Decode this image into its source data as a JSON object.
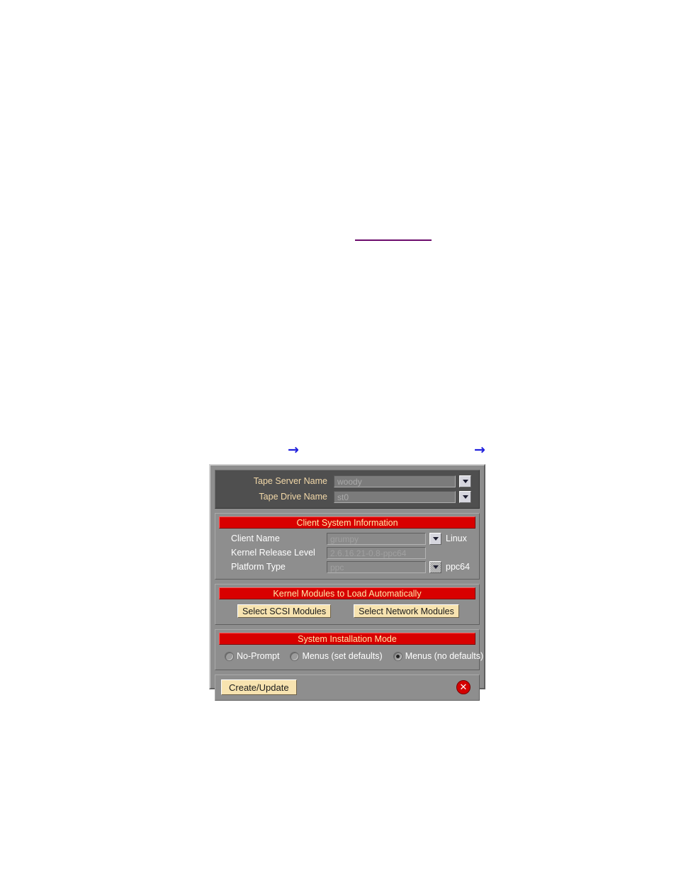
{
  "page": {
    "link_rule": "",
    "callout_arrow_glyph": "→"
  },
  "window": {
    "server_section": {
      "rows": [
        {
          "label": "Tape Server Name",
          "value": "woody",
          "dropdown": "chevron-down-icon",
          "dropdown_enabled": true
        },
        {
          "label": "Tape Drive Name",
          "value": "st0",
          "dropdown": "chevron-down-icon",
          "dropdown_enabled": true
        }
      ]
    },
    "client_section": {
      "title": "Client System Information",
      "rows": [
        {
          "label": "Client Name",
          "value": "grumpy",
          "has_dropdown": true,
          "dropdown_enabled": true,
          "suffix": "Linux"
        },
        {
          "label": "Kernel Release Level",
          "value": "2.6.16.21-0.8-ppc64",
          "has_dropdown": false,
          "dropdown_enabled": false,
          "suffix": ""
        },
        {
          "label": "Platform Type",
          "value": "ppc",
          "has_dropdown": true,
          "dropdown_enabled": false,
          "suffix": "ppc64"
        }
      ]
    },
    "modules_section": {
      "title": "Kernel Modules to Load Automatically",
      "scsi_button": "Select SCSI Modules",
      "network_button": "Select Network Modules"
    },
    "install_mode_section": {
      "title": "System Installation Mode",
      "options": [
        {
          "label": "No-Prompt",
          "selected": false
        },
        {
          "label": "Menus (set defaults)",
          "selected": false
        },
        {
          "label": "Menus (no defaults)",
          "selected": true
        }
      ]
    },
    "action_bar": {
      "create_update_label": "Create/Update",
      "close_label": "✕",
      "close_icon": "close-icon"
    }
  },
  "colors": {
    "banner_red": "#d80000",
    "banner_text": "#ffe8a8",
    "panel_gray": "#8e8e8e",
    "dark_panel": "#4f4f4f",
    "button_tan": "#f7e3b0",
    "close_red": "#d40000",
    "link_purple": "#6b0a6b",
    "arrow_blue": "#2222dd"
  }
}
